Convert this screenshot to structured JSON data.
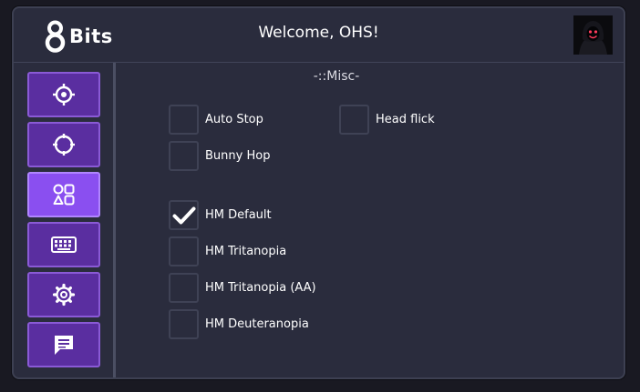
{
  "header": {
    "logo_text": "Bits",
    "welcome_text": "Welcome, OHS!"
  },
  "sidebar": {
    "items": [
      {
        "icon": "crosshair-icon",
        "active": false
      },
      {
        "icon": "target-circle-icon",
        "active": false
      },
      {
        "icon": "shapes-icon",
        "active": true
      },
      {
        "icon": "keyboard-icon",
        "active": false
      },
      {
        "icon": "gear-icon",
        "active": false
      },
      {
        "icon": "chat-icon",
        "active": false
      }
    ]
  },
  "main": {
    "section_title": "-::Misc-",
    "options": [
      {
        "label": "Auto Stop",
        "checked": false
      },
      {
        "label": "Head flick",
        "checked": false
      },
      {
        "label": "Bunny Hop",
        "checked": false
      },
      {
        "label": "HM Default",
        "checked": true
      },
      {
        "label": "HM Tritanopia",
        "checked": false
      },
      {
        "label": "HM Tritanopia (AA)",
        "checked": false
      },
      {
        "label": "HM Deuteranopia",
        "checked": false
      }
    ]
  },
  "colors": {
    "background": "#191922",
    "panel": "#2a2c3d",
    "sidebar_button": "#5a2ea0",
    "sidebar_button_active": "#8a4ff0"
  }
}
